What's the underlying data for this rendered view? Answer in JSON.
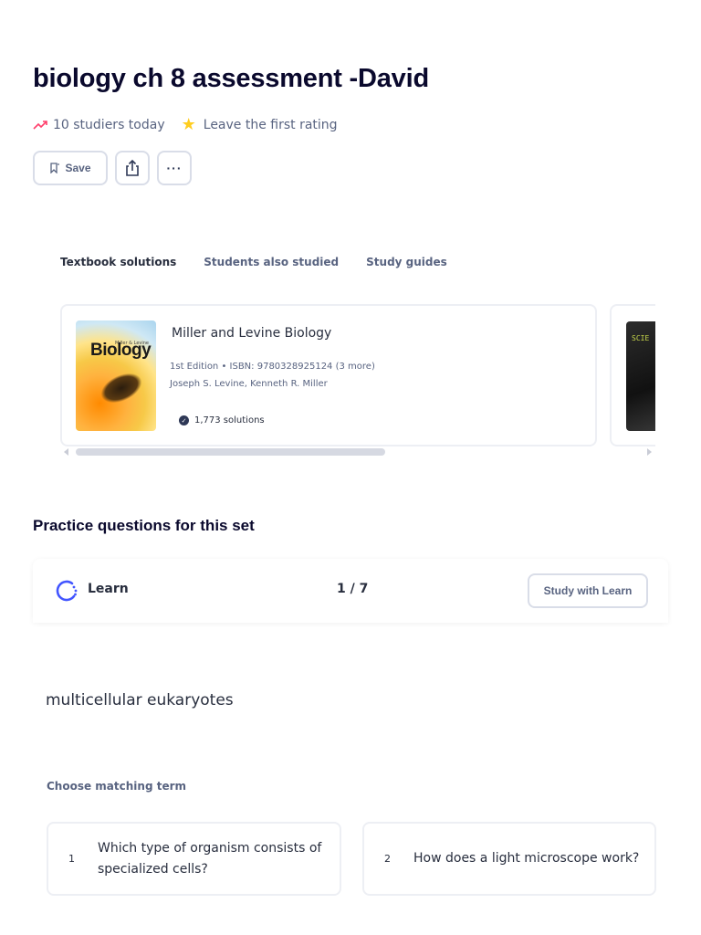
{
  "set": {
    "title": "biology ch 8 assessment -David",
    "studiers": "10 studiers today",
    "rating": "Leave the first rating"
  },
  "actions": {
    "save_label": "Save"
  },
  "tabs": [
    {
      "label": "Textbook solutions",
      "active": true
    },
    {
      "label": "Students also studied",
      "active": false
    },
    {
      "label": "Study guides",
      "active": false
    }
  ],
  "textbook": {
    "cover_title": "Biology",
    "cover_subtitle": "Miller & Levine",
    "title": "Miller and Levine Biology",
    "edition": "1st Edition • ISBN: 9780328925124 (3 more)",
    "authors": "Joseph S. Levine, Kenneth R. Miller",
    "solutions": "1,773 solutions"
  },
  "textbook2": {
    "cover_text": "SCIE"
  },
  "practice": {
    "section_title": "Practice questions for this set",
    "mode_label": "Learn",
    "progress": "1 / 7",
    "study_button": "Study with Learn",
    "prompt": "multicellular eukaryotes",
    "instruction": "Choose matching term",
    "options": [
      {
        "number": "1",
        "text": "Which type of organism consists of specialized cells?"
      },
      {
        "number": "2",
        "text": "How does a light microscope work?"
      }
    ]
  },
  "colors": {
    "accent": "#4255ff",
    "star": "#ffcd1f",
    "trend": "#ff3e6b",
    "heading": "#0a092d"
  }
}
